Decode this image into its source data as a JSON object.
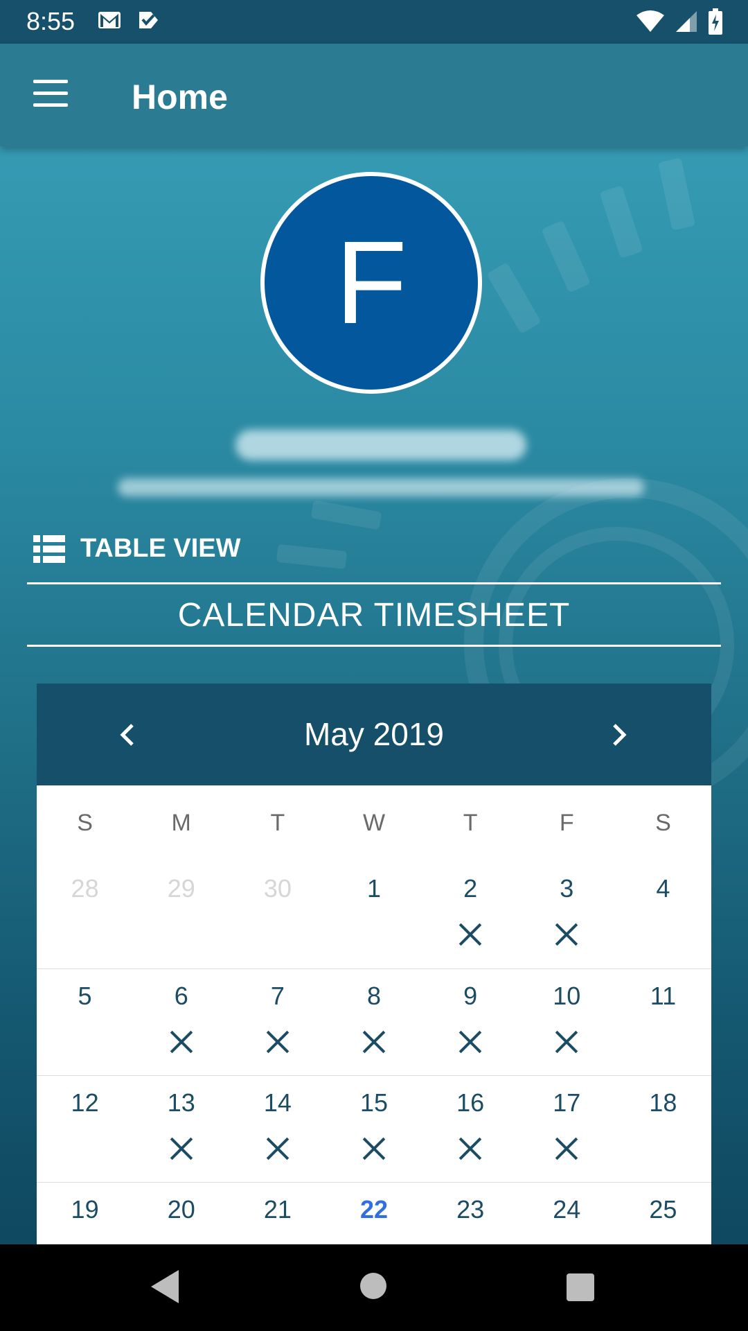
{
  "status_bar": {
    "time": "8:55",
    "left_icons": [
      "gmail-icon",
      "checkbox-app-icon"
    ],
    "right_icons": [
      "wifi-icon",
      "signal-icon",
      "battery-charging-icon"
    ]
  },
  "app_bar": {
    "menu_icon": "hamburger-menu-icon",
    "title": "Home"
  },
  "profile": {
    "avatar_letter": "F",
    "avatar_color": "#02579d"
  },
  "table_view": {
    "icon": "list-icon",
    "label": "TABLE VIEW"
  },
  "section_title": "CALENDAR TIMESHEET",
  "calendar": {
    "month_year": "May  2019",
    "prev_icon": "chevron-left-icon",
    "next_icon": "chevron-right-icon",
    "weekdays": [
      "S",
      "M",
      "T",
      "W",
      "T",
      "F",
      "S"
    ],
    "weeks": [
      [
        {
          "d": "28",
          "muted": true
        },
        {
          "d": "29",
          "muted": true
        },
        {
          "d": "30",
          "muted": true
        },
        {
          "d": "1"
        },
        {
          "d": "2",
          "x": true
        },
        {
          "d": "3",
          "x": true
        },
        {
          "d": "4"
        }
      ],
      [
        {
          "d": "5"
        },
        {
          "d": "6",
          "x": true
        },
        {
          "d": "7",
          "x": true
        },
        {
          "d": "8",
          "x": true
        },
        {
          "d": "9",
          "x": true
        },
        {
          "d": "10",
          "x": true
        },
        {
          "d": "11"
        }
      ],
      [
        {
          "d": "12"
        },
        {
          "d": "13",
          "x": true
        },
        {
          "d": "14",
          "x": true
        },
        {
          "d": "15",
          "x": true
        },
        {
          "d": "16",
          "x": true
        },
        {
          "d": "17",
          "x": true
        },
        {
          "d": "18"
        }
      ],
      [
        {
          "d": "19"
        },
        {
          "d": "20"
        },
        {
          "d": "21"
        },
        {
          "d": "22",
          "today": true
        },
        {
          "d": "23"
        },
        {
          "d": "24"
        },
        {
          "d": "25"
        }
      ]
    ],
    "colors": {
      "header_bg": "#154f69",
      "day_text": "#1b4c64",
      "muted_text": "#d6d6d6",
      "today_text": "#2f6fe0"
    }
  },
  "nav_bar": {
    "back_icon": "back-triangle-icon",
    "home_icon": "home-circle-icon",
    "recents_icon": "recents-square-icon"
  }
}
